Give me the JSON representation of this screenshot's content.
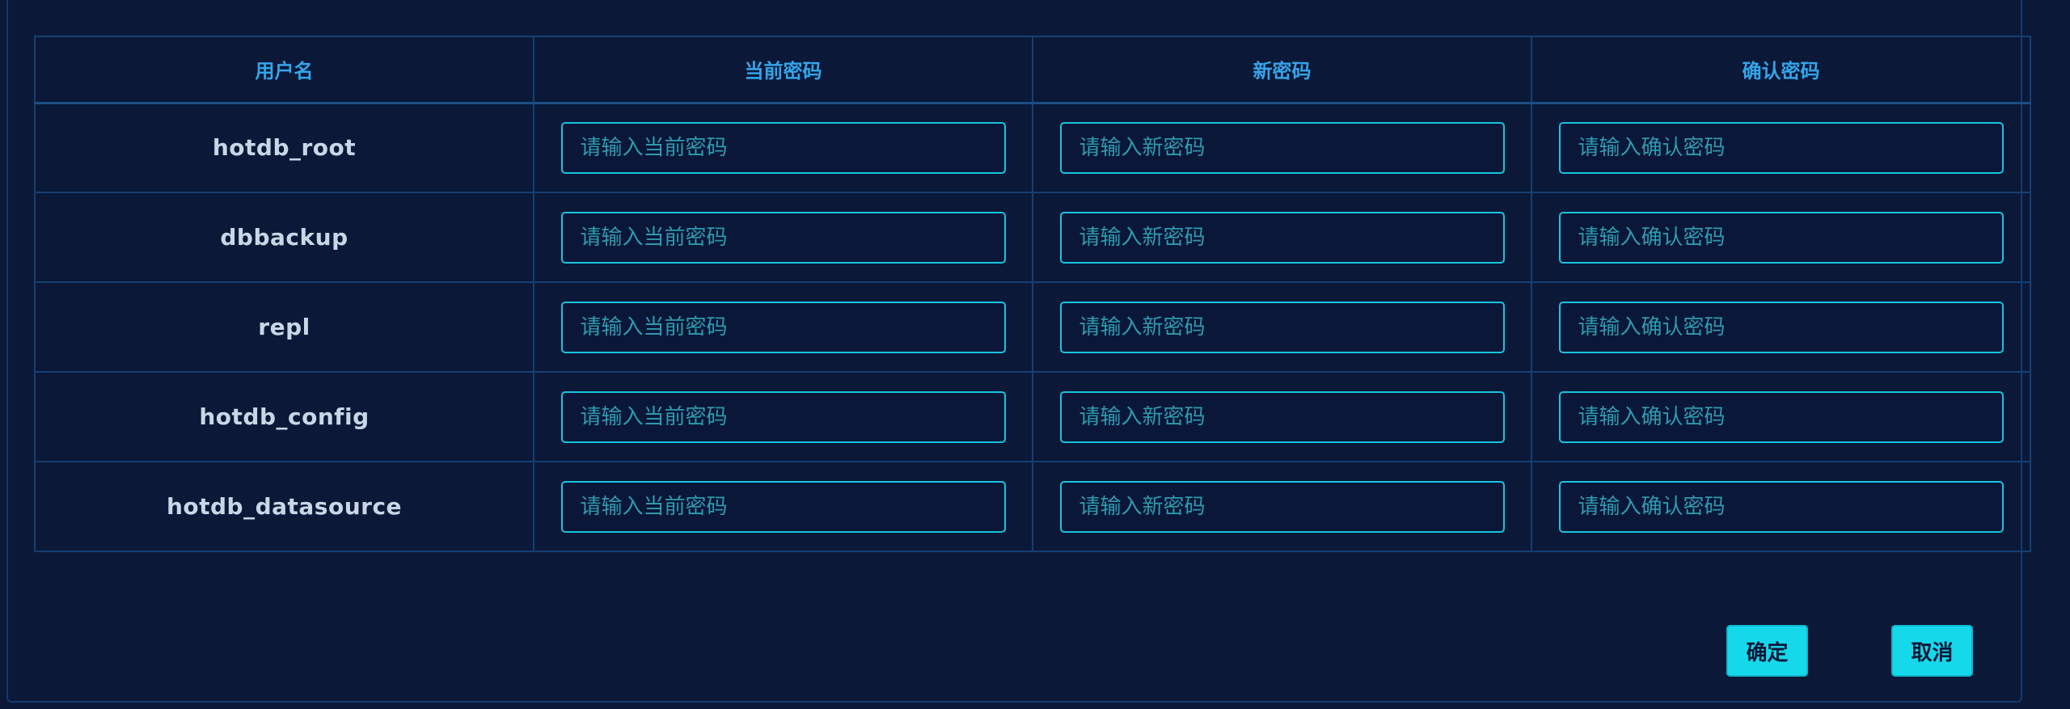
{
  "table": {
    "headers": {
      "username": "用户名",
      "current_password": "当前密码",
      "new_password": "新密码",
      "confirm_password": "确认密码"
    },
    "placeholders": {
      "current_password": "请输入当前密码",
      "new_password": "请输入新密码",
      "confirm_password": "请输入确认密码"
    },
    "rows": [
      {
        "username": "hotdb_root"
      },
      {
        "username": "dbbackup"
      },
      {
        "username": "repl"
      },
      {
        "username": "hotdb_config"
      },
      {
        "username": "hotdb_datasource"
      }
    ]
  },
  "actions": {
    "confirm_label": "确定",
    "cancel_label": "取消"
  },
  "colors": {
    "background": "#0b1838",
    "header_text": "#35a4e8",
    "input_border": "#18c4de",
    "button_bg": "#16d8eb"
  }
}
